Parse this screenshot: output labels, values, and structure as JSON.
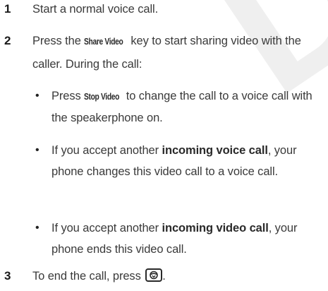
{
  "watermark": "DR",
  "steps": [
    {
      "number": "1",
      "text": "Start a normal voice call."
    },
    {
      "number": "2",
      "text_before": "Press the ",
      "key": "Share Video",
      "text_after": " key to start sharing video with the caller. During the call:"
    },
    {
      "number": "3",
      "text": "To end the call, press ",
      "text_end": ".",
      "key_icon": "end-call-key-icon"
    }
  ],
  "bullets": [
    {
      "text_before": "Press ",
      "key": "Stop Video",
      "text_after": " to change the call to a voice call with the speakerphone on."
    },
    {
      "text_before": "If you accept another ",
      "bold": "incoming voice call",
      "text_after": ", your phone changes this video call to a voice call."
    },
    {
      "text_before": "If you accept another ",
      "bold": "incoming video call",
      "text_after": ", your phone ends this video call."
    }
  ],
  "bullet_glyph": "•"
}
